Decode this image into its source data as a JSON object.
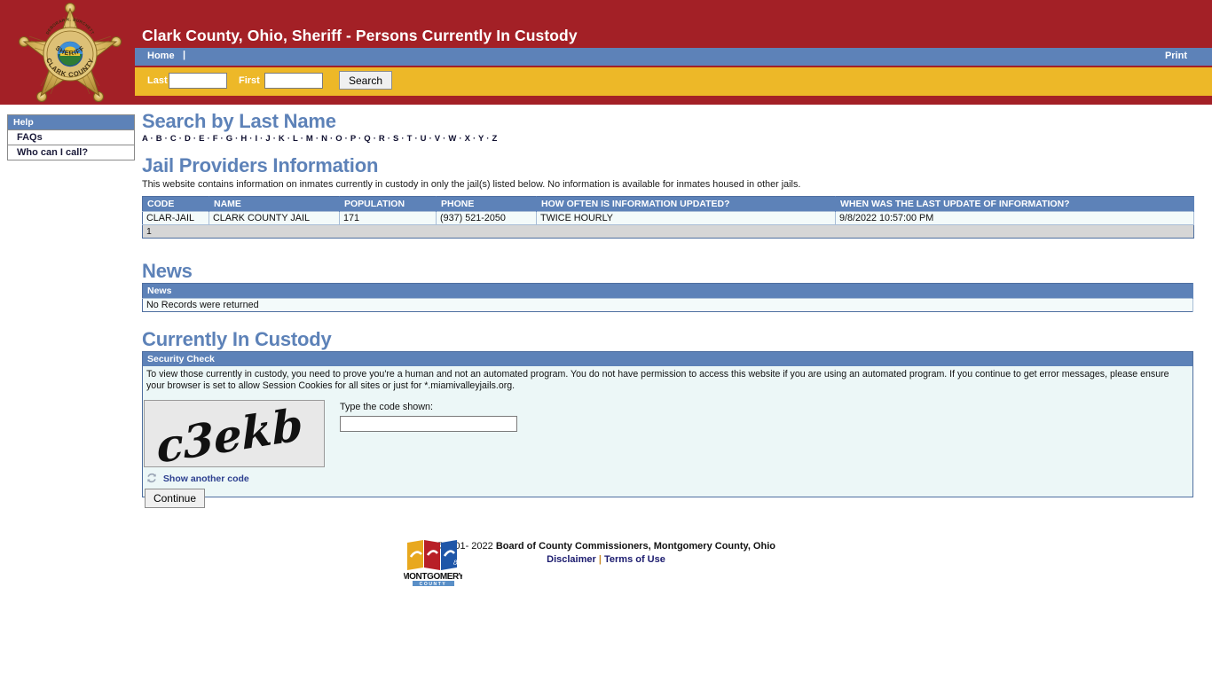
{
  "header": {
    "title": "Clark County, Ohio, Sheriff - Persons Currently In Custody",
    "badge": {
      "top_text": "DEBORAH K. BURCHETT",
      "mid_text": "SHERIFF",
      "bottom_text": "CLARK COUNTY",
      "seal_text": "CLARK COUNTY OHIO"
    },
    "nav": {
      "home_label": "Home",
      "separator": "|",
      "print_label": "Print"
    },
    "search": {
      "last_label": "Last",
      "last_value": "",
      "last_placeholder": "",
      "first_label": "First",
      "first_value": "",
      "first_placeholder": "",
      "search_button": "Search"
    },
    "colors": {
      "banner_red": "#a32026",
      "nav_blue": "#5d82b8",
      "search_gold": "#edb828"
    }
  },
  "sidebar": {
    "header": "Help",
    "items": [
      {
        "label": "FAQs"
      },
      {
        "label": "Who can I call?"
      }
    ]
  },
  "search_by_last_name": {
    "title": "Search by Last Name",
    "letters": [
      "A",
      "B",
      "C",
      "D",
      "E",
      "F",
      "G",
      "H",
      "I",
      "J",
      "K",
      "L",
      "M",
      "N",
      "O",
      "P",
      "Q",
      "R",
      "S",
      "T",
      "U",
      "V",
      "W",
      "X",
      "Y",
      "Z"
    ],
    "separator": "·"
  },
  "jail_providers": {
    "title": "Jail Providers Information",
    "intro": "This website contains information on inmates currently in custody in only the jail(s) listed below. No information is available for inmates housed in other jails.",
    "columns": [
      "CODE",
      "NAME",
      "POPULATION",
      "PHONE",
      "HOW OFTEN IS INFORMATION UPDATED?",
      "WHEN WAS THE LAST UPDATE OF INFORMATION?"
    ],
    "rows": [
      {
        "code": "CLAR-JAIL",
        "name": "CLARK COUNTY JAIL",
        "population": "171",
        "phone": "(937) 521-2050",
        "update_frequency": "TWICE HOURLY",
        "last_update": "9/8/2022 10:57:00 PM"
      }
    ],
    "pager": "1"
  },
  "news": {
    "title": "News",
    "column": "News",
    "empty_message": "No Records were returned"
  },
  "custody": {
    "title": "Currently In Custody",
    "security_header": "Security Check",
    "security_text": "To view those currently in custody, you need to prove you're a human and not an automated program. You do not have permission to access this website if you are using an automated program. If you continue to get error messages, please ensure your browser is set to allow Session Cookies for all sites or just for *.miamivalleyjails.org.",
    "captcha_code": "c3ekb",
    "show_another_label": "Show another code",
    "code_label": "Type the code shown:",
    "code_value": "",
    "code_placeholder": "",
    "continue_label": "Continue"
  },
  "footer": {
    "copyright_prefix": "©2001- 2022 ",
    "copyright_owner": "Board of County Commissioners, Montgomery County, Ohio",
    "disclaimer_label": "Disclaimer",
    "links_separator": "|",
    "terms_label": "Terms of Use",
    "logo_name": "MONTGOMERY",
    "logo_subtitle": "COUNTY"
  }
}
